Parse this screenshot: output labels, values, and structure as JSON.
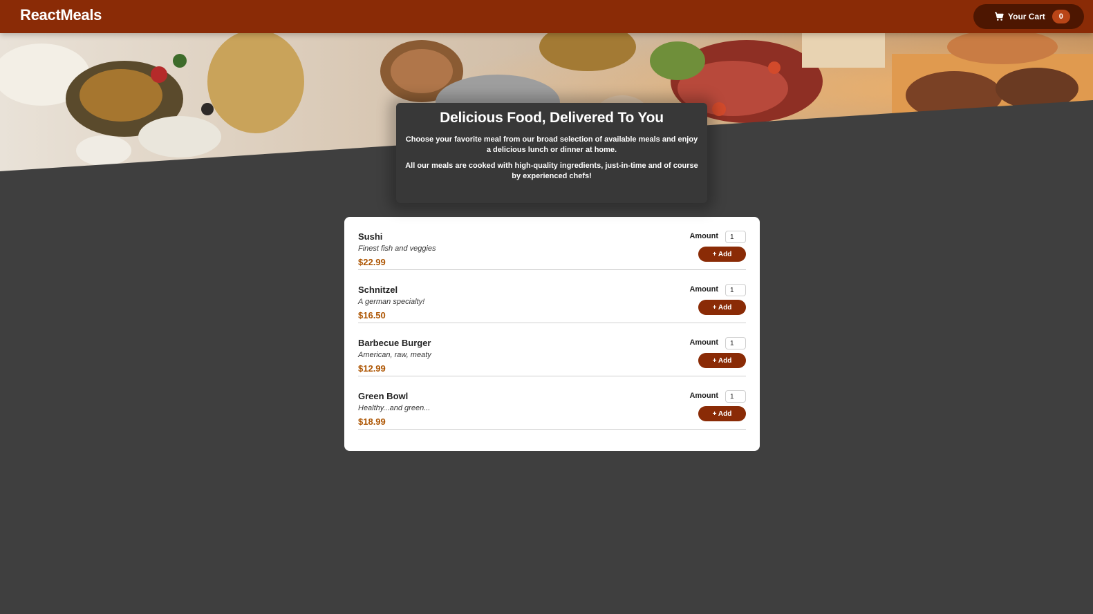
{
  "header": {
    "brand": "ReactMeals",
    "cart": {
      "label": "Your Cart",
      "count": "0",
      "icon": "cart-icon"
    }
  },
  "summary": {
    "title": "Delicious Food, Delivered To You",
    "paragraph1": "Choose your favorite meal from our broad selection of available meals and enjoy a delicious lunch or dinner at home.",
    "paragraph2": "All our meals are cooked with high-quality ingredients, just-in-time and of course by experienced chefs!"
  },
  "meals": [
    {
      "name": "Sushi",
      "description": "Finest fish and veggies",
      "price": "$22.99",
      "amount_label": "Amount",
      "amount_value": "1",
      "add_label": "+ Add"
    },
    {
      "name": "Schnitzel",
      "description": "A german specialty!",
      "price": "$16.50",
      "amount_label": "Amount",
      "amount_value": "1",
      "add_label": "+ Add"
    },
    {
      "name": "Barbecue Burger",
      "description": "American, raw, meaty",
      "price": "$12.99",
      "amount_label": "Amount",
      "amount_value": "1",
      "add_label": "+ Add"
    },
    {
      "name": "Green Bowl",
      "description": "Healthy...and green...",
      "price": "$18.99",
      "amount_label": "Amount",
      "amount_value": "1",
      "add_label": "+ Add"
    }
  ],
  "colors": {
    "header_bg": "#8a2b06",
    "cart_button_bg": "#4d1601",
    "badge_bg": "#b94517",
    "page_bg": "#3f3f3f",
    "summary_bg": "#383838",
    "price": "#ad5502"
  }
}
